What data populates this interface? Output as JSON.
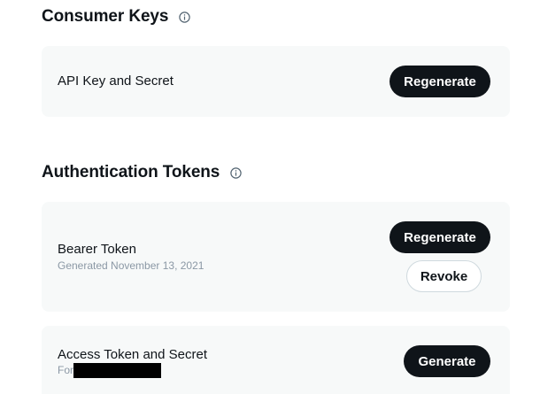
{
  "consumer_keys": {
    "title": "Consumer Keys",
    "info_icon": "info-circle-icon",
    "api_key": {
      "label": "API Key and Secret",
      "regenerate_label": "Regenerate"
    }
  },
  "auth_tokens": {
    "title": "Authentication Tokens",
    "info_icon": "info-circle-icon",
    "bearer": {
      "label": "Bearer Token",
      "sublabel": "Generated November 13, 2021",
      "regenerate_label": "Regenerate",
      "revoke_label": "Revoke"
    },
    "access": {
      "label": "Access Token and Secret",
      "sublabel": "For",
      "generate_label": "Generate"
    }
  },
  "colors": {
    "card_bg": "#f7f9f9",
    "button_dark": "#0f1419",
    "secondary_text": "#8b98a5"
  }
}
